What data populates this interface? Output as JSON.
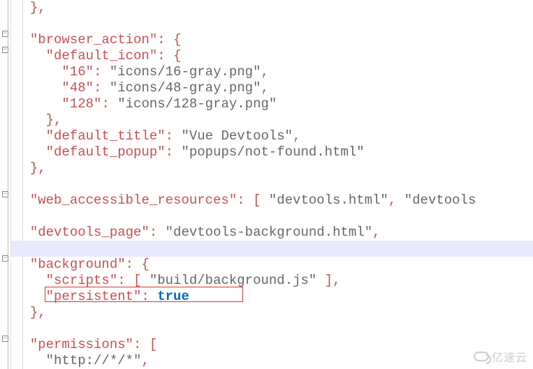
{
  "code": {
    "close_brace_comma": "},",
    "browser_action_key": "\"browser_action\"",
    "default_icon_key": "\"default_icon\"",
    "icon16_key": "\"16\"",
    "icon16_val": "\"icons/16-gray.png\"",
    "icon48_key": "\"48\"",
    "icon48_val": "\"icons/48-gray.png\"",
    "icon128_key": "\"128\"",
    "icon128_val": "\"icons/128-gray.png\"",
    "default_title_key": "\"default_title\"",
    "default_title_val": "\"Vue Devtools\"",
    "default_popup_key": "\"default_popup\"",
    "default_popup_val": "\"popups/not-found.html\"",
    "war_key": "\"web_accessible_resources\"",
    "war_val1": "\"devtools.html\"",
    "war_val2": "\"devtools",
    "devtools_page_key": "\"devtools_page\"",
    "devtools_page_val": "\"devtools-background.html\"",
    "background_key": "\"background\"",
    "scripts_key": "\"scripts\"",
    "scripts_val": "\"build/background.js\"",
    "persistent_key": "\"persistent\"",
    "persistent_val": "true",
    "permissions_key": "\"permissions\"",
    "perm1_val": "\"http://*/*\""
  },
  "gutter": {
    "fold_symbol": "−"
  },
  "watermark": {
    "text": "亿速云"
  },
  "colors": {
    "key": "#c94f4f",
    "punct": "#b85450",
    "string": "#666",
    "bool": "#0066cc",
    "highlight": "#e8e8ff",
    "redbox": "#d33"
  }
}
